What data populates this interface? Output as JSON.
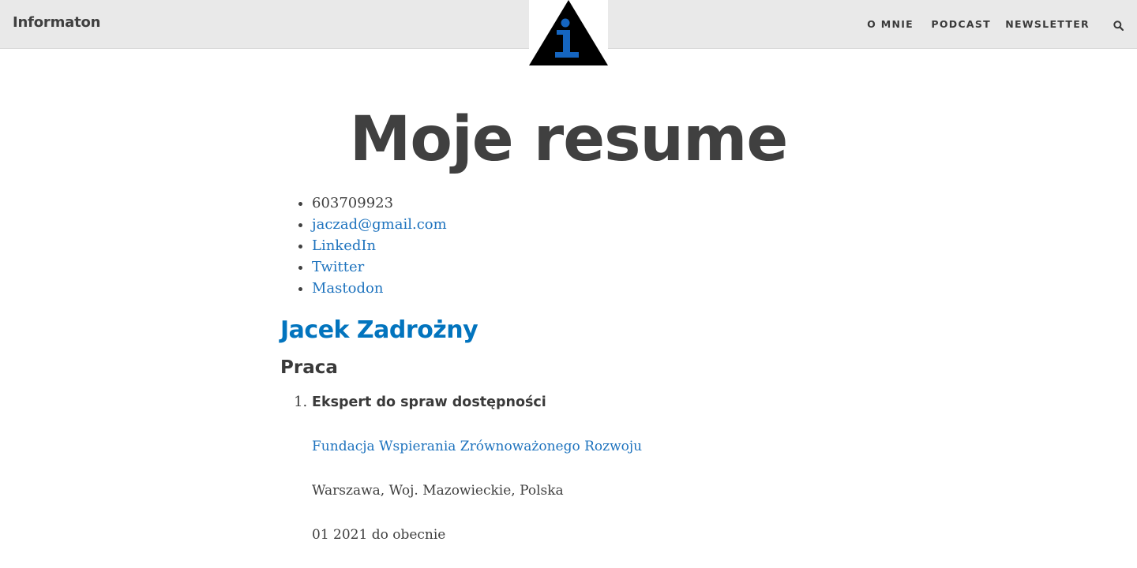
{
  "header": {
    "site_title": "Informaton",
    "logo_name": "info-logo",
    "nav": [
      {
        "label": "O MNIE"
      },
      {
        "label": "PODCAST"
      },
      {
        "label": "NEWSLETTER"
      }
    ],
    "search_icon": "search-icon",
    "colors": {
      "bar": "#e9e9e9",
      "logo_blue": "#1565c0"
    }
  },
  "page": {
    "title": "Moje resume"
  },
  "contact": {
    "phone": "603709923",
    "email": "jaczad@gmail.com"
  },
  "social": [
    "LinkedIn",
    "Twitter",
    "Mastodon"
  ],
  "profile": {
    "name": "Jacek Zadrożny"
  },
  "work": {
    "heading": "Praca",
    "jobs": [
      {
        "title": "Ekspert do spraw dostępności",
        "organization": "Fundacja Wspierania Zrównoważonego Rozwoju",
        "location": "Warszawa, Woj. Mazowieckie, Polska",
        "dates": "01 2021 do obecnie"
      }
    ]
  },
  "colors": {
    "link": "#1e73be",
    "name_heading": "#0274be",
    "text": "#404040"
  }
}
